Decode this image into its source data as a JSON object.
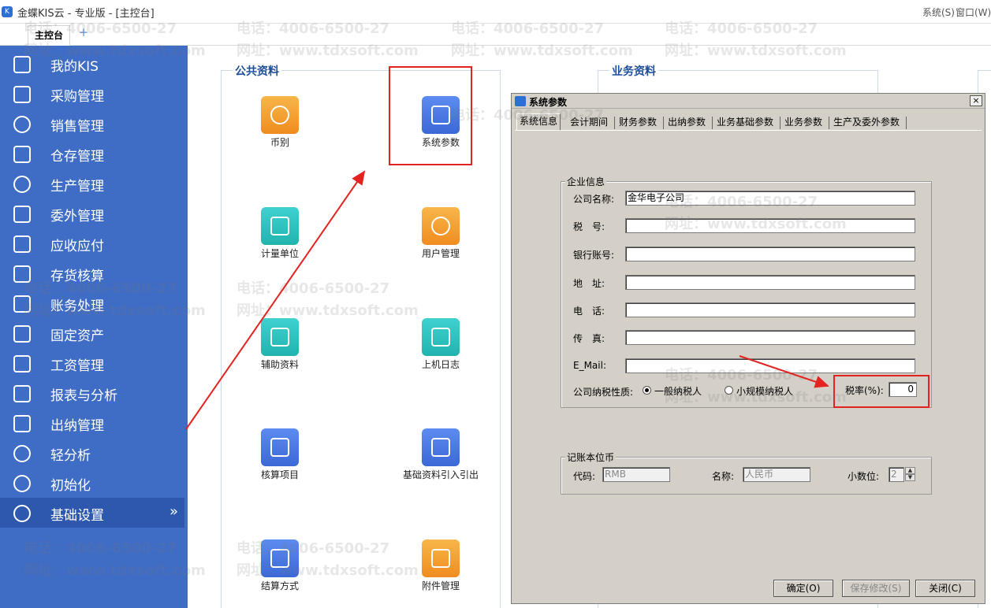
{
  "app": {
    "title": "金蝶KIS云 - 专业版 - [主控台]",
    "logo_text": "K",
    "menu_system": "系统(S)",
    "menu_window": "窗口(W)"
  },
  "tabs": [
    {
      "label": "主控台"
    }
  ],
  "tab_add": "+",
  "sidebar": {
    "items": [
      {
        "label": "我的KIS"
      },
      {
        "label": "采购管理"
      },
      {
        "label": "销售管理"
      },
      {
        "label": "仓存管理"
      },
      {
        "label": "生产管理"
      },
      {
        "label": "委外管理"
      },
      {
        "label": "应收应付"
      },
      {
        "label": "存货核算"
      },
      {
        "label": "账务处理"
      },
      {
        "label": "固定资产"
      },
      {
        "label": "工资管理"
      },
      {
        "label": "报表与分析"
      },
      {
        "label": "出纳管理"
      },
      {
        "label": "轻分析"
      },
      {
        "label": "初始化"
      },
      {
        "label": "基础设置"
      }
    ],
    "expand_glyph": "»"
  },
  "main": {
    "public_title": "公共资料",
    "business_title": "业务资料",
    "tiles": [
      {
        "label": "币别"
      },
      {
        "label": "系统参数"
      },
      {
        "label": "计量单位"
      },
      {
        "label": "用户管理"
      },
      {
        "label": "辅助资料"
      },
      {
        "label": "上机日志"
      },
      {
        "label": "核算项目"
      },
      {
        "label": "基础资料引入引出"
      },
      {
        "label": "结算方式"
      },
      {
        "label": "附件管理"
      }
    ]
  },
  "watermark": {
    "phone": "电话：4006-6500-27",
    "site": "网址：www.tdxsoft.com"
  },
  "dialog": {
    "title": "系统参数",
    "close": "×",
    "tabs": [
      "系统信息",
      "会计期间",
      "财务参数",
      "出纳参数",
      "业务基础参数",
      "业务参数",
      "生产及委外参数"
    ],
    "company_group": "企业信息",
    "fields": {
      "company_name_label": "公司名称:",
      "company_name_value": "金华电子公司",
      "tax_no_label": "税　号:",
      "bank_label": "银行账号:",
      "address_label": "地　址:",
      "phone_label": "电　话:",
      "fax_label": "传　真:",
      "email_label": "E_Mail:",
      "taxpayer_label": "公司纳税性质:",
      "taxpayer_general": "一般纳税人",
      "taxpayer_small": "小规模纳税人",
      "tax_rate_label": "税率(%):",
      "tax_rate_value": "0"
    },
    "currency_group": "记账本位币",
    "currency": {
      "code_label": "代码:",
      "code_value": "RMB",
      "name_label": "名称:",
      "name_value": "人民币",
      "decimals_label": "小数位:",
      "decimals_value": "2"
    },
    "buttons": {
      "ok": "确定(O)",
      "save": "保存修改(S)",
      "close": "关闭(C)"
    }
  },
  "colors": {
    "sidebar": "#3f6cc5",
    "sidebar_active": "#2d58ad",
    "dialog_bg": "#d4d0c8",
    "highlight": "#e3231f",
    "section_title": "#1d4e9c"
  }
}
